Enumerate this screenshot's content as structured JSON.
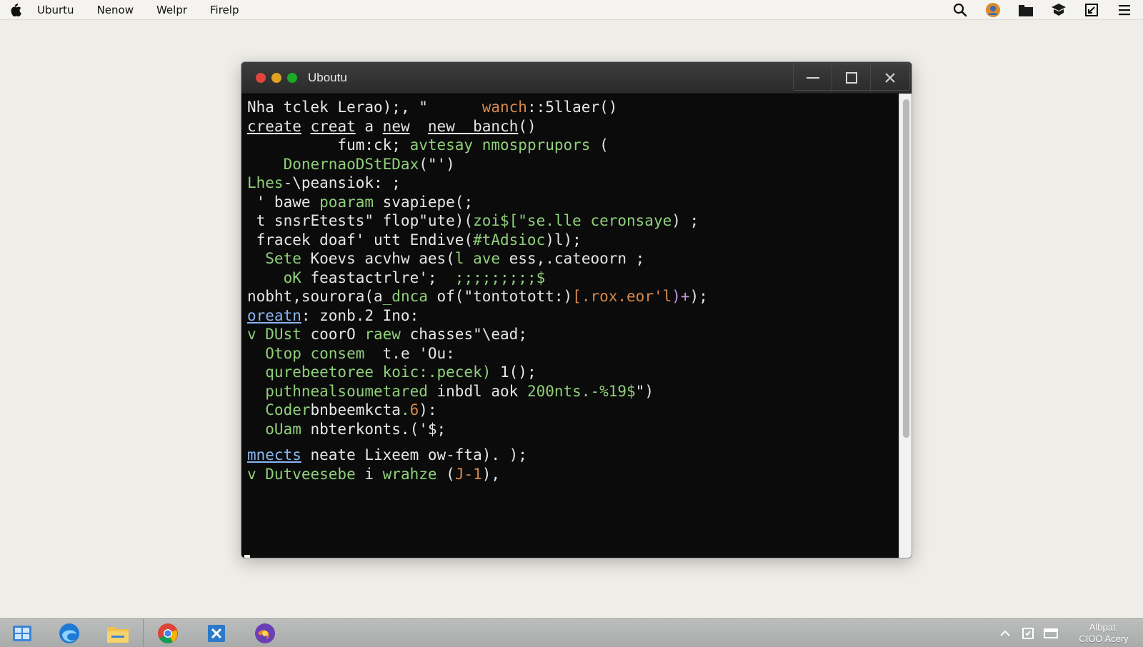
{
  "menubar": {
    "apple_icon": "apple-logo-icon",
    "items": [
      "Uburtu",
      "Nenow",
      "Welpr",
      "Firelp"
    ],
    "tray_icons": [
      "search-icon",
      "avatar-icon",
      "folder-icon",
      "cast-icon",
      "window-icon",
      "menu-icon"
    ]
  },
  "window": {
    "title": "Uboutu"
  },
  "terminal": {
    "lines": [
      [
        [
          "c-white",
          "Nha"
        ],
        [
          "c-white",
          " tclek Lerao);, \"      "
        ],
        [
          "c-orange",
          "wanch"
        ],
        [
          "c-white",
          "::5llaer()"
        ]
      ],
      [
        [
          "c-ul",
          "create"
        ],
        [
          "c-white",
          " "
        ],
        [
          "c-ul",
          "creat"
        ],
        [
          "c-white",
          " a "
        ],
        [
          "c-ul",
          "new"
        ],
        [
          "c-white",
          "  "
        ],
        [
          "c-ul",
          "new  banch"
        ],
        [
          "c-white",
          "()"
        ]
      ],
      [
        [
          "c-white",
          "          fum:ck; "
        ],
        [
          "c-green",
          "avtesay nmospprupors"
        ],
        [
          "c-white",
          " ("
        ]
      ],
      [
        [
          "c-green",
          "    DonernaoDStEDax"
        ],
        [
          "c-white",
          "(\"')"
        ]
      ],
      [
        [
          "c-green",
          "Lhes"
        ],
        [
          "c-white",
          "-\\peansiok: ;"
        ]
      ],
      [
        [
          "c-white",
          " ' bawe "
        ],
        [
          "c-green",
          "poaram"
        ],
        [
          "c-white",
          " svapiepe("
        ],
        [
          "c-white",
          ";"
        ]
      ],
      [
        [
          "c-white",
          " t snsrEtests\" flop\"ute)("
        ],
        [
          "c-green",
          "zoi$[\"se.lle ceronsaye"
        ],
        [
          "c-white",
          ") ;"
        ]
      ],
      [
        [
          "c-white",
          " fracek doaf' utt Endive("
        ],
        [
          "c-green",
          "#tAdsioc"
        ],
        [
          "c-white",
          ")l);"
        ]
      ],
      [
        [
          "c-green",
          "  Sete"
        ],
        [
          "c-white",
          " Koevs "
        ],
        [
          "c-white",
          "acvhw aes("
        ],
        [
          "c-green",
          "l ave"
        ],
        [
          "c-white",
          " ess,.cateoorn ;"
        ]
      ],
      [
        [
          "c-green",
          "    oK"
        ],
        [
          "c-white",
          " feastactrlre'; "
        ],
        [
          "c-green",
          " ;;;;;;;;;$"
        ]
      ],
      [
        [
          "c-white",
          "nobht,sourora(a"
        ],
        [
          "c-green",
          "_dnca"
        ],
        [
          "c-white",
          " of(\"tontotott:)"
        ],
        [
          "c-orange",
          "[.rox.eor'l"
        ],
        [
          "c-purple",
          ")+"
        ],
        [
          "c-white",
          ");"
        ]
      ],
      [
        [
          "c-blue",
          "oreatn"
        ],
        [
          "c-white",
          ": zonb.2 Ino:"
        ]
      ],
      [
        [
          "c-green",
          "v DUst"
        ],
        [
          "c-white",
          " coorO "
        ],
        [
          "c-green",
          "raew"
        ],
        [
          "c-white",
          " chasses\"\\ead;"
        ]
      ],
      [
        [
          "c-green",
          "  Otop consem"
        ],
        [
          "c-white",
          "  t.e 'Ou:"
        ]
      ],
      [
        [
          "c-green",
          "  qurebeetoree koic:.pecek)"
        ],
        [
          "c-white",
          " 1();"
        ]
      ],
      [
        [
          "c-green",
          "  puthnealsoumetared"
        ],
        [
          "c-white",
          " inbdl aok "
        ],
        [
          "c-green",
          "200nts.-%19$"
        ],
        [
          "c-white",
          "\")"
        ]
      ],
      [
        [
          "c-green",
          "  Coder"
        ],
        [
          "c-white",
          "bnbeemkcta"
        ],
        [
          "c-green",
          "."
        ],
        [
          "c-orange",
          "6"
        ],
        [
          "c-white",
          "):"
        ]
      ],
      [
        [
          "c-green",
          "  oUam"
        ],
        [
          "c-white",
          " nbterkonts.('$;"
        ]
      ]
    ],
    "lines_after_gap": [
      [
        [
          "c-blue",
          "mnects"
        ],
        [
          "c-white",
          " neate Lixeem ow-fta)."
        ],
        [
          "c-white",
          " );"
        ]
      ],
      [
        [
          "c-green",
          "v Dutveesebe"
        ],
        [
          "c-white",
          " i "
        ],
        [
          "c-green",
          "wrahze"
        ],
        [
          "c-white",
          " ("
        ],
        [
          "c-orange",
          "J-1"
        ],
        [
          "c-white",
          "),"
        ]
      ]
    ]
  },
  "taskbar": {
    "apps": [
      "windows-start-icon",
      "edge-browser-icon",
      "file-explorer-icon",
      "chrome-icon",
      "excel-icon",
      "firefox-icon"
    ],
    "tray": [
      "chevron-up-icon",
      "security-icon",
      "network-icon"
    ],
    "clock_line1": "Albpat:",
    "clock_line2": "CIOO Acery"
  },
  "colors": {
    "desktop": "#efede7",
    "terminal_bg": "#0b0b0b",
    "text_white": "#e6e6e6",
    "text_green": "#8fd07a",
    "text_orange": "#d7894a",
    "text_purple": "#c795e4",
    "text_blue": "#8ab6f0"
  }
}
